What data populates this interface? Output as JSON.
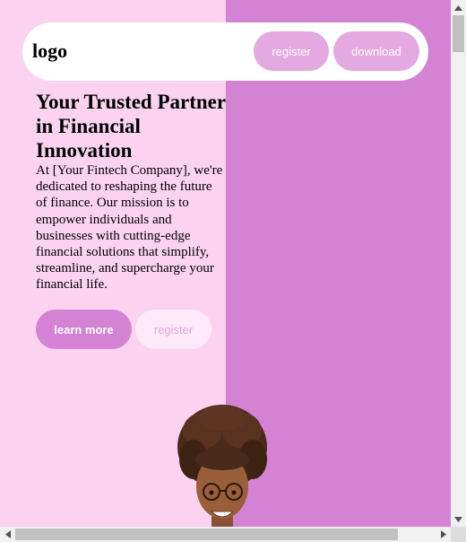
{
  "nav": {
    "logo": "logo",
    "register_label": "register",
    "download_label": "download"
  },
  "hero": {
    "title": "Your Trusted Partner in Financial Innovation",
    "description": "At [Your Fintech Company], we're dedicated to reshaping the future of finance. Our mission is to empower individuals and businesses with cutting-edge financial solutions that simplify, streamline, and supercharge your financial life.",
    "learn_more_label": "learn more",
    "register_label": "register"
  },
  "colors": {
    "left_bg": "#fbd3f1",
    "right_bg": "#d382d4",
    "button_pink": "#e3a9e0",
    "button_pale": "#fde9f8"
  },
  "icons": {
    "scroll_up": "arrow-up-icon",
    "scroll_down": "arrow-down-icon",
    "scroll_left": "arrow-left-icon",
    "scroll_right": "arrow-right-icon"
  }
}
